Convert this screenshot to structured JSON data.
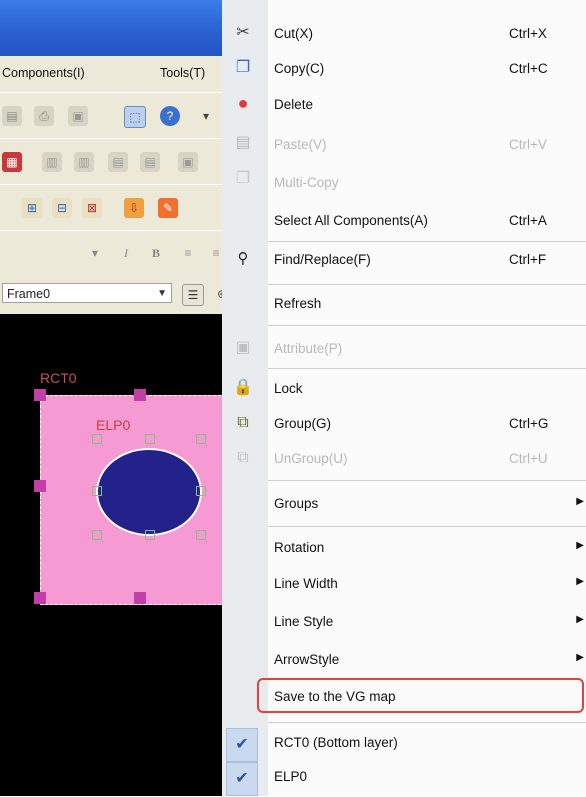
{
  "menubar": {
    "components": "Components(I)",
    "tools": "Tools(T)"
  },
  "toolbar": {
    "italic": "I",
    "bold": "B"
  },
  "frame_select": "Frame0",
  "canvas": {
    "rect_label": "RCT0",
    "ellipse_label": "ELP0",
    "rect_color": "#f59ad2",
    "ellipse_color": "#22228a",
    "handle_color": "#c040a8"
  },
  "context_menu": {
    "cut": {
      "label": "Cut(X)",
      "shortcut": "Ctrl+X",
      "icon": "scissors-icon"
    },
    "copy": {
      "label": "Copy(C)",
      "shortcut": "Ctrl+C",
      "icon": "copy-icon"
    },
    "delete": {
      "label": "Delete",
      "icon": "delete-icon"
    },
    "paste": {
      "label": "Paste(V)",
      "shortcut": "Ctrl+V",
      "icon": "paste-icon",
      "disabled": true
    },
    "multi_copy": {
      "label": "Multi-Copy",
      "icon": "multi-copy-icon",
      "disabled": true
    },
    "select_all": {
      "label": "Select All Components(A)",
      "shortcut": "Ctrl+A"
    },
    "find_replace": {
      "label": "Find/Replace(F)",
      "shortcut": "Ctrl+F",
      "icon": "binoculars-icon"
    },
    "refresh": {
      "label": "Refresh"
    },
    "attribute": {
      "label": "Attribute(P)",
      "icon": "attribute-icon",
      "disabled": true
    },
    "lock": {
      "label": "Lock",
      "icon": "lock-icon"
    },
    "group": {
      "label": "Group(G)",
      "shortcut": "Ctrl+G",
      "icon": "group-icon"
    },
    "ungroup": {
      "label": "UnGroup(U)",
      "shortcut": "Ctrl+U",
      "icon": "ungroup-icon",
      "disabled": true
    },
    "groups": {
      "label": "Groups"
    },
    "rotation": {
      "label": "Rotation"
    },
    "line_width": {
      "label": "Line Width"
    },
    "line_style": {
      "label": "Line Style"
    },
    "arrow_style": {
      "label": "ArrowStyle"
    },
    "save_vg": {
      "label": "Save to the VG map"
    },
    "rct0": {
      "label": "RCT0 (Bottom layer)",
      "checked": true
    },
    "elp0": {
      "label": "ELP0",
      "checked": true
    },
    "highlight_color": "#e8403c"
  }
}
